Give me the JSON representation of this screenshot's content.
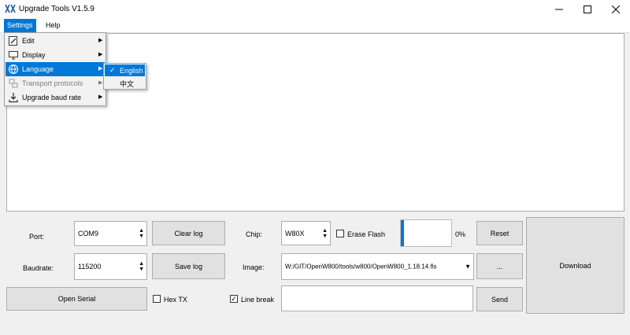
{
  "window": {
    "title": "Upgrade Tools V1.5.9",
    "minimize": "–",
    "maximize": "☐",
    "close": "✕"
  },
  "menubar": {
    "settings": "Settings",
    "help": "Help"
  },
  "settings_menu": {
    "items": [
      {
        "label": "Edit",
        "icon": "edit-icon"
      },
      {
        "label": "Display",
        "icon": "monitor-icon"
      },
      {
        "label": "Language",
        "icon": "globe-icon"
      },
      {
        "label": "Transport protocols",
        "icon": "transport-icon"
      },
      {
        "label": "Upgrade baud rate",
        "icon": "download-icon"
      }
    ],
    "arrow": "▶"
  },
  "language_menu": {
    "check": "✓",
    "english": "English",
    "chinese": "中文"
  },
  "controls": {
    "port_label": "Port:",
    "port_value": "COM9",
    "clear_log": "Clear log",
    "chip_label": "Chip:",
    "chip_value": "W80X",
    "erase_flash": "Erase Flash",
    "progress_text": "0%",
    "progress_value": 0,
    "reset": "Reset",
    "download": "Download",
    "baudrate_label": "Baudrate:",
    "baudrate_value": "115200",
    "save_log": "Save log",
    "image_label": "Image:",
    "image_value": "W:/GIT/OpenW800/tools/w800/OpenW800_1.18.14.fls",
    "browse": "...",
    "open_serial": "Open Serial",
    "hex_tx": "Hex TX",
    "line_break": "Line break",
    "send": "Send",
    "send_input": ""
  },
  "colors": {
    "accent": "#0078d7",
    "progress": "#0078d7"
  }
}
